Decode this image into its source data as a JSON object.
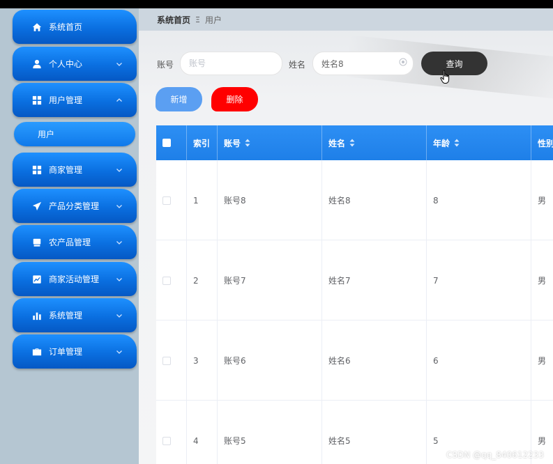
{
  "sidebar": {
    "items": [
      {
        "label": "系统首页",
        "icon": "home-icon"
      },
      {
        "label": "个人中心",
        "icon": "user-icon"
      },
      {
        "label": "用户管理",
        "icon": "grid-icon"
      },
      {
        "label": "商家管理",
        "icon": "grid-icon"
      },
      {
        "label": "产品分类管理",
        "icon": "send-icon"
      },
      {
        "label": "农产品管理",
        "icon": "monitor-icon"
      },
      {
        "label": "商家活动管理",
        "icon": "chart-icon"
      },
      {
        "label": "系统管理",
        "icon": "bar-chart-icon"
      },
      {
        "label": "订单管理",
        "icon": "briefcase-icon"
      }
    ],
    "submenu": {
      "label": "用户"
    }
  },
  "breadcrumb": {
    "home": "系统首页",
    "separator": "Ξ",
    "current": "用户"
  },
  "search": {
    "account_label": "账号",
    "account_placeholder": "账号",
    "account_value": "",
    "name_label": "姓名",
    "name_placeholder": "姓名",
    "name_value": "姓名8"
  },
  "buttons": {
    "query": "查询",
    "add": "新增",
    "delete": "删除"
  },
  "table": {
    "columns": [
      "索引",
      "账号",
      "姓名",
      "年龄",
      "性别"
    ],
    "rows": [
      {
        "index": "1",
        "account": "账号8",
        "name": "姓名8",
        "age": "8",
        "gender": "男"
      },
      {
        "index": "2",
        "account": "账号7",
        "name": "姓名7",
        "age": "7",
        "gender": "男"
      },
      {
        "index": "3",
        "account": "账号6",
        "name": "姓名6",
        "age": "6",
        "gender": "男"
      },
      {
        "index": "4",
        "account": "账号5",
        "name": "姓名5",
        "age": "5",
        "gender": "男"
      }
    ]
  },
  "watermark": "CSDN @qq_840612233",
  "colors": {
    "sidebar_bg": "#b5c6d2",
    "menu_blue": "#0a6fe0",
    "table_header": "#2d8ff4",
    "query_button": "#333333",
    "add_button": "#5b9ff2",
    "delete_button": "#ff0000"
  }
}
